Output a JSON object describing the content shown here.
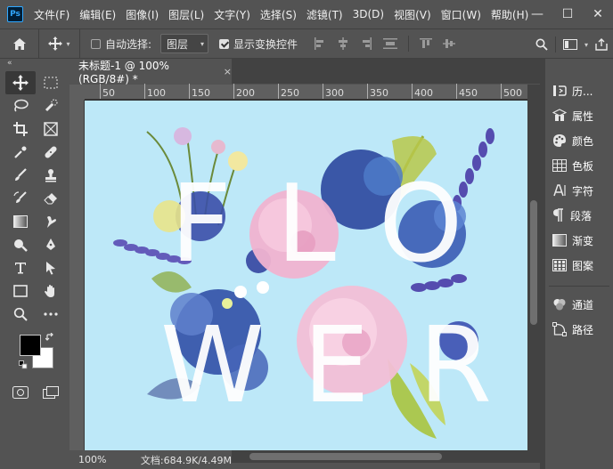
{
  "app": {
    "logo_text": "Ps",
    "menu": [
      "文件(F)",
      "编辑(E)",
      "图像(I)",
      "图层(L)",
      "文字(Y)",
      "选择(S)",
      "滤镜(T)",
      "3D(D)",
      "视图(V)",
      "窗口(W)",
      "帮助(H)"
    ],
    "window_controls": {
      "minimize": "—",
      "maximize": "☐",
      "close": "✕"
    }
  },
  "options_bar": {
    "auto_select_label": "自动选择:",
    "auto_select_checked": false,
    "auto_select_target": "图层",
    "show_transform_label": "显示变换控件",
    "show_transform_checked": true
  },
  "collapse_arrows": "«",
  "document": {
    "tab_title": "未标题-1 @ 100%(RGB/8#) *",
    "tab_close": "×",
    "ruler_labels": [
      "50",
      "100",
      "150",
      "200",
      "250",
      "300",
      "350",
      "400",
      "450",
      "500"
    ],
    "canvas_letters_row1": [
      "F",
      "L",
      "O"
    ],
    "canvas_letters_row2": [
      "W",
      "E",
      "R"
    ],
    "background_color": "#bde8f8"
  },
  "status": {
    "zoom": "100%",
    "doc_size": "文档:684.9K/4.49M"
  },
  "panels": [
    {
      "icon": "history-icon",
      "label": "历..."
    },
    {
      "icon": "properties-icon",
      "label": "属性"
    },
    {
      "icon": "color-icon",
      "label": "颜色"
    },
    {
      "icon": "swatches-icon",
      "label": "色板"
    },
    {
      "icon": "character-icon",
      "label": "字符"
    },
    {
      "icon": "paragraph-icon",
      "label": "段落"
    },
    {
      "icon": "gradient-icon",
      "label": "渐变"
    },
    {
      "icon": "patterns-icon",
      "label": "图案"
    },
    {
      "icon": "channels-icon",
      "label": "通道"
    },
    {
      "icon": "paths-icon",
      "label": "路径"
    }
  ],
  "colors": {
    "foreground": "#000000",
    "background": "#ffffff",
    "ui_base": "#535353",
    "ps_blue": "#31a8ff"
  }
}
